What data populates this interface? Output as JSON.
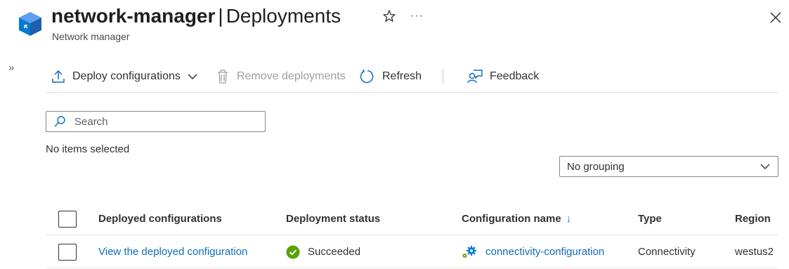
{
  "header": {
    "resource_name": "network-manager",
    "separator": "|",
    "page_name": "Deployments",
    "subtitle": "Network manager",
    "icons": {
      "resource": "network-manager-cube-icon",
      "favorite": "star-icon",
      "more": "ellipsis-icon",
      "close": "close-icon"
    },
    "more_glyph": "···"
  },
  "sidebar": {
    "expand_glyph": "»"
  },
  "toolbar": {
    "deploy_label": "Deploy configurations",
    "remove_label": "Remove deployments",
    "refresh_label": "Refresh",
    "feedback_label": "Feedback"
  },
  "search": {
    "placeholder": "Search",
    "value": ""
  },
  "selection_status": "No items selected",
  "grouping": {
    "selected": "No grouping"
  },
  "table": {
    "columns": {
      "deployed": "Deployed configurations",
      "status": "Deployment status",
      "config_name": "Configuration name",
      "sort_indicator": "↓",
      "type": "Type",
      "region": "Region"
    },
    "rows": [
      {
        "deployed": "View the deployed configuration",
        "status": "Succeeded",
        "config_name": "connectivity-configuration",
        "type": "Connectivity",
        "region": "westus2"
      }
    ]
  },
  "colors": {
    "accent": "#0f6cbd",
    "success": "#57a300",
    "disabled": "#a19f9d",
    "text": "#323130"
  }
}
